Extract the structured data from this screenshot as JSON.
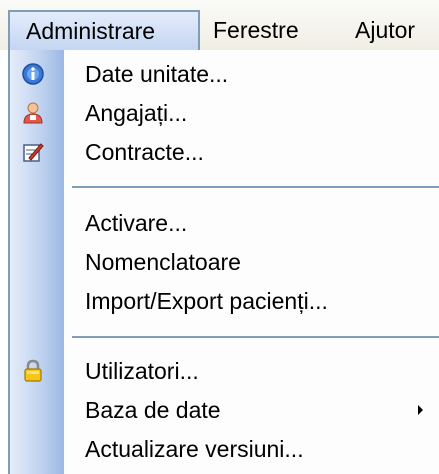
{
  "menubar": {
    "items": [
      {
        "label": "Administrare",
        "active": true
      },
      {
        "label": "Ferestre"
      },
      {
        "label": "Ajutor"
      }
    ]
  },
  "dropdown": {
    "groups": [
      [
        {
          "label": "Date unitate...",
          "icon": "info-icon"
        },
        {
          "label": "Angajați...",
          "icon": "person-icon"
        },
        {
          "label": "Contracte...",
          "icon": "document-edit-icon"
        }
      ],
      [
        {
          "label": "Activare..."
        },
        {
          "label": "Nomenclatoare"
        },
        {
          "label": "Import/Export pacienți..."
        }
      ],
      [
        {
          "label": "Utilizatori...",
          "icon": "lock-icon"
        },
        {
          "label": "Baza de date",
          "submenu": true
        },
        {
          "label": "Actualizare versiuni..."
        }
      ]
    ]
  },
  "colors": {
    "border": "#7f9db9",
    "gutter": "#c1d3f0",
    "menubar": "#f0eee4"
  }
}
